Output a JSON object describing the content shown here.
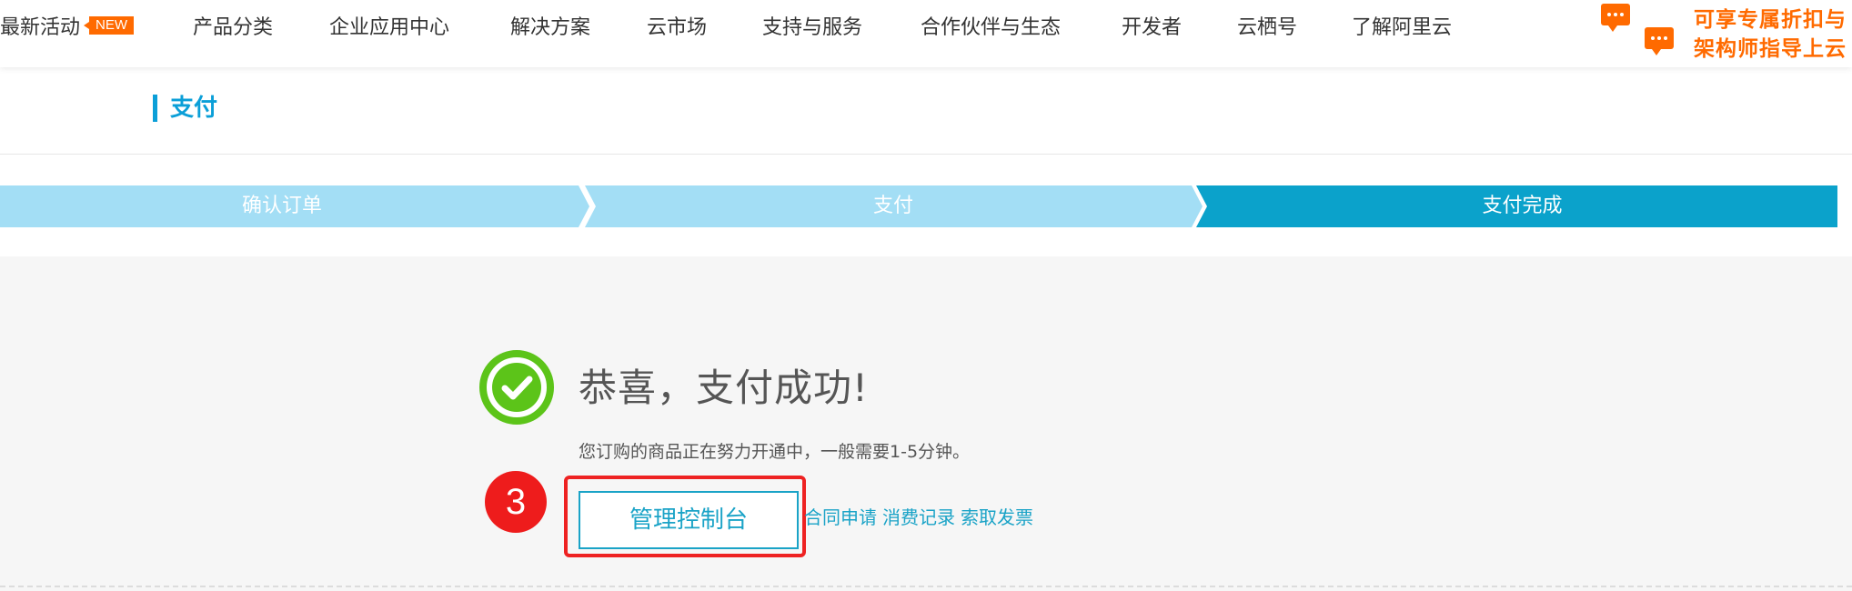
{
  "nav": {
    "items": [
      {
        "label": "最新活动",
        "badge": "NEW"
      },
      {
        "label": "产品分类"
      },
      {
        "label": "企业应用中心"
      },
      {
        "label": "解决方案"
      },
      {
        "label": "云市场"
      },
      {
        "label": "支持与服务"
      },
      {
        "label": "合作伙伴与生态"
      },
      {
        "label": "开发者"
      },
      {
        "label": "云栖号"
      },
      {
        "label": "了解阿里云"
      }
    ],
    "promo": {
      "line1": "可享专属折扣与",
      "line2": "架构师指导上云",
      "icon": "chat-bubble-icon"
    }
  },
  "page": {
    "section_title": "支付"
  },
  "steps": {
    "items": [
      {
        "label": "确认订单",
        "state": "done"
      },
      {
        "label": "支付",
        "state": "done"
      },
      {
        "label": "支付完成",
        "state": "active"
      }
    ],
    "colors": {
      "done": "#a3def5",
      "active": "#0ba2cb"
    }
  },
  "success": {
    "icon": "check-circle-icon",
    "title": "恭喜，支付成功!",
    "description": "您订购的商品正在努力开通中，一般需要1-5分钟。",
    "console_button": "管理控制台",
    "links": [
      "合同申请",
      "消费记录",
      "索取发票"
    ],
    "annotation_number": "3"
  },
  "colors": {
    "brand_orange": "#ff6a00",
    "brand_blue": "#0b9fd8",
    "link_blue": "#1aa3c7",
    "success_green": "#5cc419",
    "annotation_red": "#ee1c1c"
  }
}
